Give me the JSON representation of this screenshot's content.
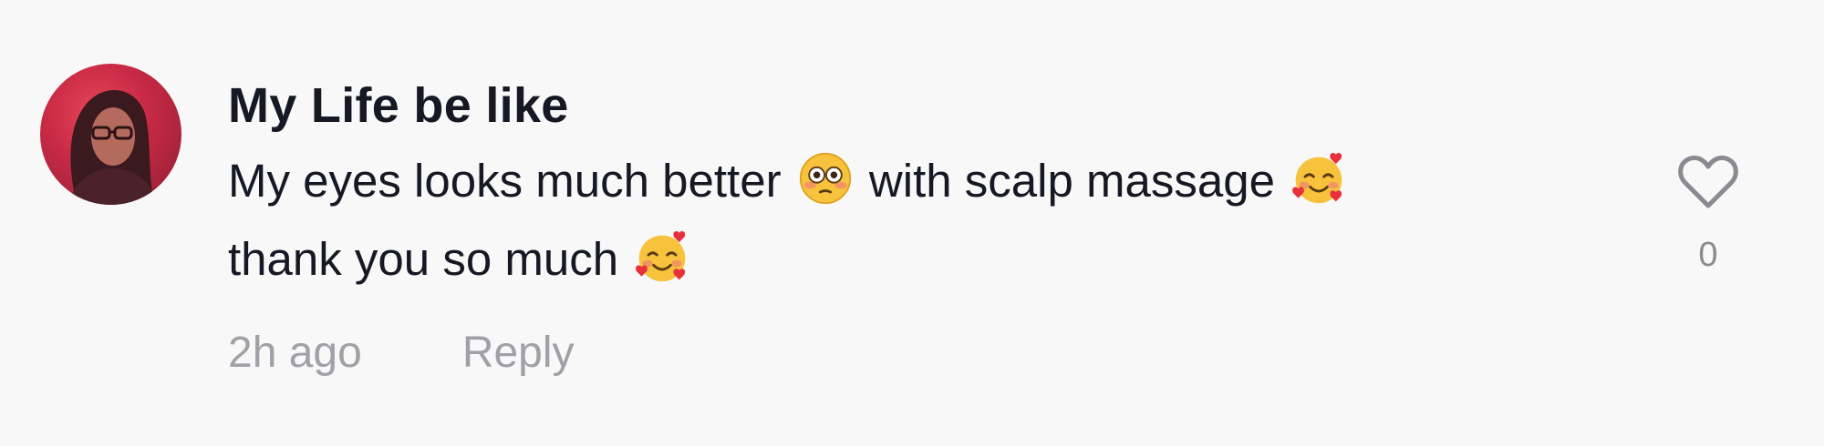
{
  "comment": {
    "username": "My Life be like",
    "text_part1": "My eyes looks much better",
    "text_part2": "with scalp massage",
    "text_part3": "thank you so much",
    "emoji_1": "flushed-face",
    "emoji_2": "smiling-face-with-hearts",
    "emoji_3": "smiling-face-with-hearts",
    "timestamp": "2h ago",
    "reply_label": "Reply",
    "like_count": "0",
    "like_icon": "heart-outline-icon"
  },
  "colors": {
    "background": "#f8f8f8",
    "username": "#161823",
    "meta_text": "#a0a0a6",
    "like_icon": "#8a8b91",
    "avatar_bg": "#c92a45"
  }
}
